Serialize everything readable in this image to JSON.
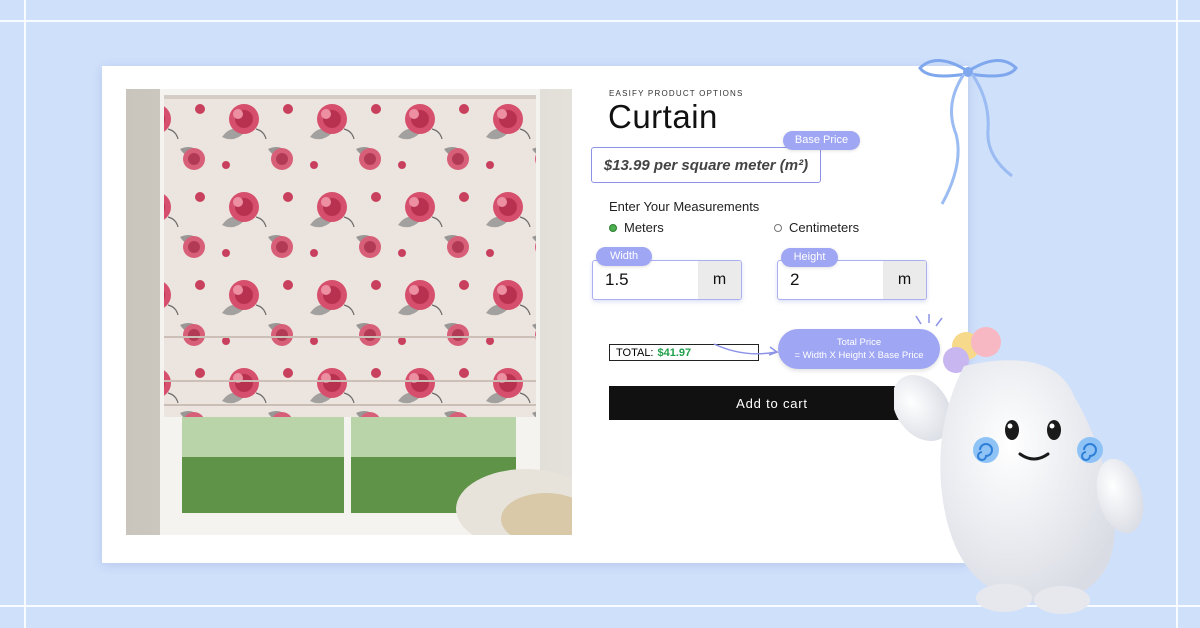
{
  "product": {
    "brand": "EASIFY PRODUCT OPTIONS",
    "title": "Curtain",
    "base_price_text": "$13.99 per square meter (m²)",
    "base_price_badge": "Base Price"
  },
  "measurements": {
    "label": "Enter Your Measurements",
    "units": [
      {
        "label": "Meters",
        "selected": true
      },
      {
        "label": "Centimeters",
        "selected": false
      }
    ],
    "width": {
      "badge": "Width",
      "value": "1.5",
      "unit": "m"
    },
    "height": {
      "badge": "Height",
      "value": "2",
      "unit": "m"
    }
  },
  "total": {
    "label": "TOTAL:",
    "value": "$41.97",
    "pill_title": "Total Price",
    "pill_formula": "= Width X Height X Base Price"
  },
  "cart": {
    "button_label": "Add to cart"
  },
  "colors": {
    "background": "#cfe0fb",
    "accent": "#9fa6f3",
    "total_green": "#1fa04a",
    "button": "#111111"
  }
}
